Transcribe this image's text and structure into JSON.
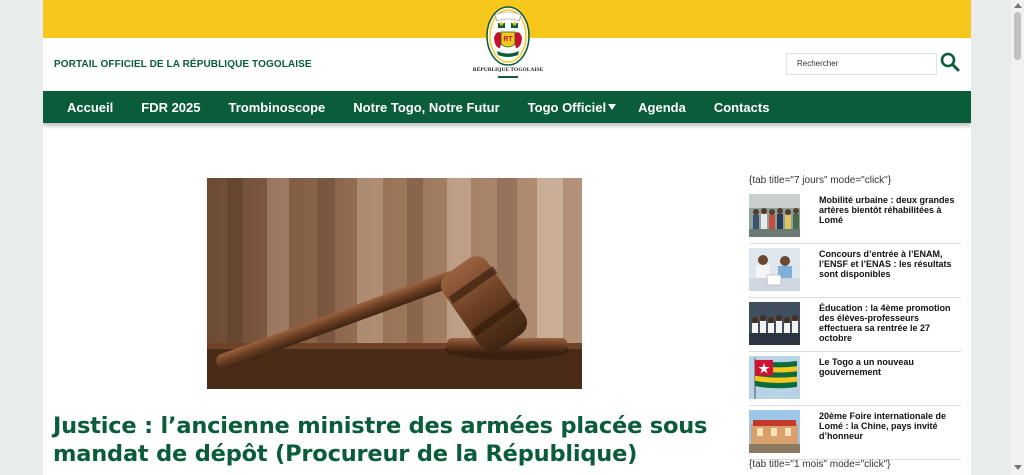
{
  "header": {
    "portal_title": "PORTAIL OFFICIEL DE LA RÉPUBLIQUE TOGOLAISE",
    "logo_text": "RÉPUBLIQUE TOGOLAISE",
    "search_placeholder": "Rechercher"
  },
  "nav": {
    "items": [
      "Accueil",
      "FDR 2025",
      "Trombinoscope",
      "Notre Togo, Notre Futur",
      "Togo Officiel",
      "Agenda",
      "Contacts"
    ]
  },
  "article": {
    "title": "Justice : l’ancienne ministre des armées placée sous mandat de dépôt (Procureur de la République)"
  },
  "sidebar": {
    "tab_7_jours": "{tab title=\"7 jours\" mode=\"click\"}",
    "tab_1_mois": "{tab title=\"1 mois\" mode=\"click\"}",
    "items": [
      {
        "title": "Mobilité urbaine : deux grandes artères bientôt réhabilitées à Lomé"
      },
      {
        "title": "Concours d’entrée à l’ENAM, l’ENSF et l’ENAS : les résultats sont disponibles"
      },
      {
        "title": "Éducation : la 4ème promotion des élèves-professeurs effectuera sa rentrée le 27 octobre"
      },
      {
        "title": "Le Togo a un nouveau gouvernement"
      },
      {
        "title": "20ème Foire internationale de Lomé : la Chine, pays invité d’honneur"
      }
    ]
  },
  "colors": {
    "brand_green": "#0a5c3a",
    "brand_yellow": "#f7c81b"
  }
}
